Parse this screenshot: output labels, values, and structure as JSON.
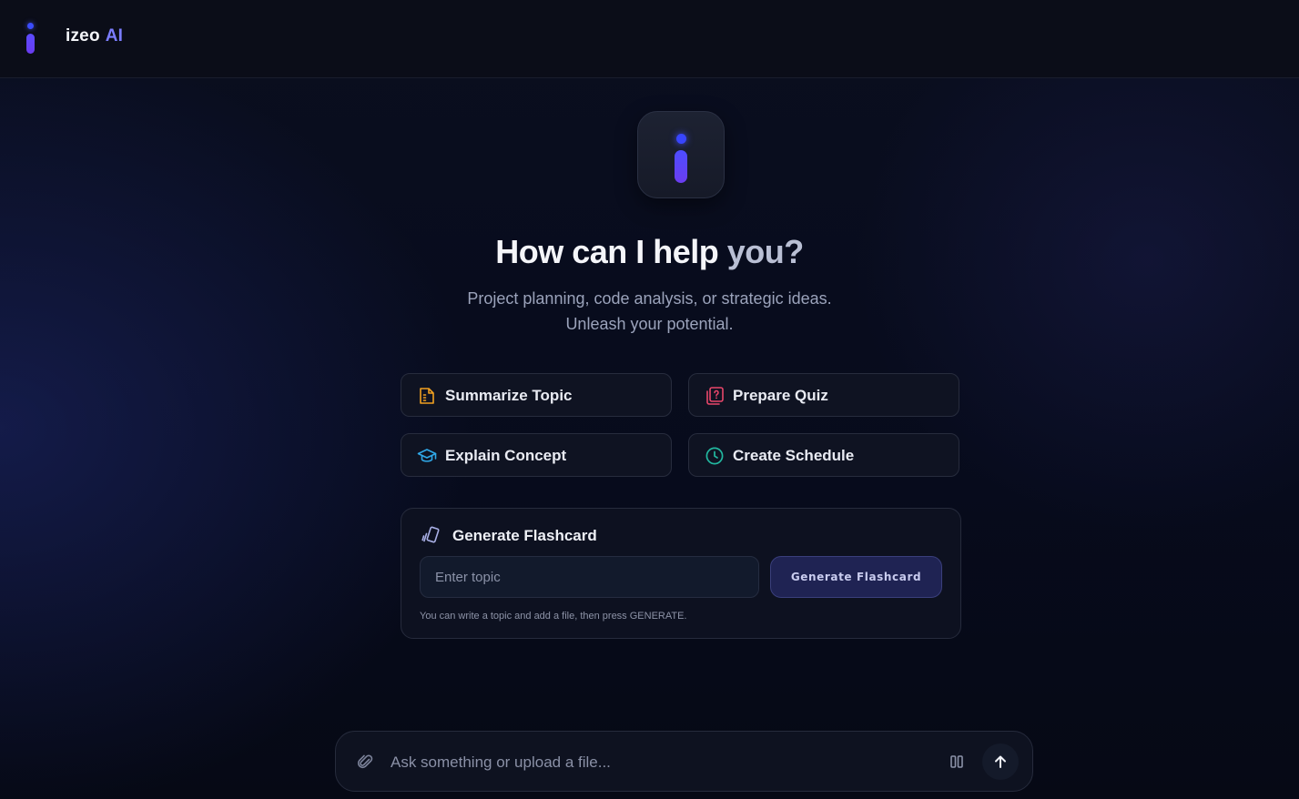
{
  "brand": {
    "name": "izeo",
    "suffix": "AI"
  },
  "hero": {
    "title_main": "How can I help",
    "title_tail": "you?",
    "subtitle_line1": "Project planning, code analysis, or strategic ideas.",
    "subtitle_line2": "Unleash your potential."
  },
  "actions": [
    {
      "label": "Summarize Topic",
      "icon": "document-icon",
      "color": "#f0a020"
    },
    {
      "label": "Prepare Quiz",
      "icon": "quiz-icon",
      "color": "#e8466a"
    },
    {
      "label": "Explain Concept",
      "icon": "graduation-cap-icon",
      "color": "#2fa8e8"
    },
    {
      "label": "Create Schedule",
      "icon": "clock-icon",
      "color": "#22b8a0"
    }
  ],
  "flashcard": {
    "title": "Generate Flashcard",
    "input_placeholder": "Enter topic",
    "button_label": "Generate Flashcard",
    "hint": "You can write a topic and add a file, then press GENERATE."
  },
  "composer": {
    "placeholder": "Ask something or upload a file..."
  },
  "colors": {
    "accent": "#5b4bff",
    "brand_ai": "#7b7dff",
    "background": "#070b18"
  }
}
